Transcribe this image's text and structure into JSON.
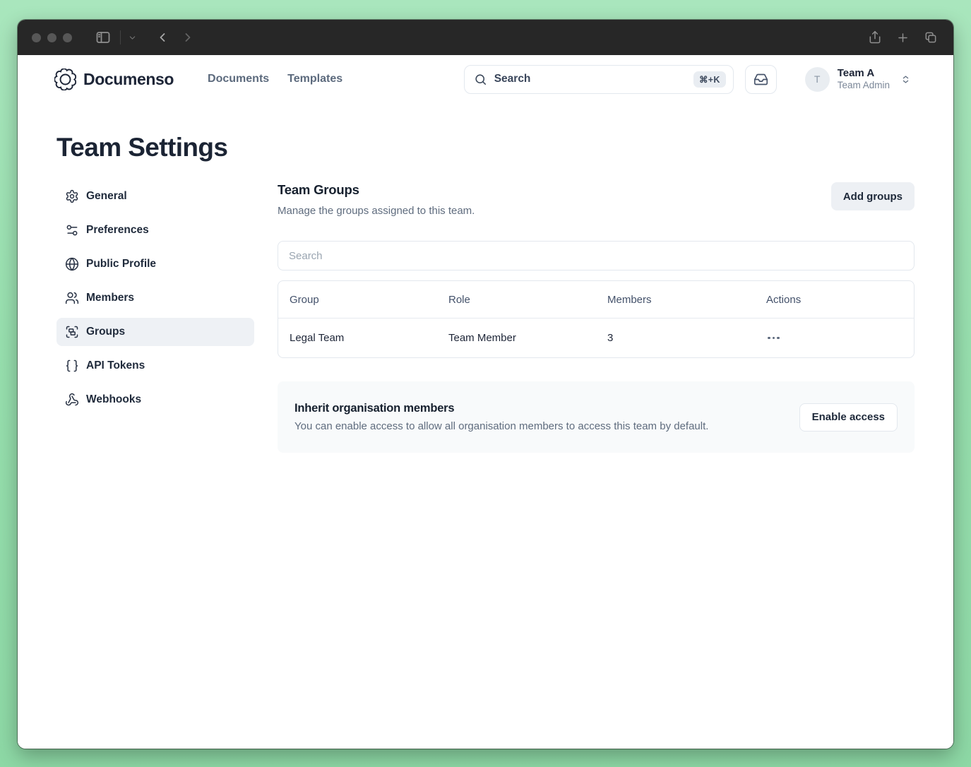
{
  "colors": {
    "desktop_background": "#97dfae",
    "titlebar": "#272727",
    "brand_ink": "#1d2537",
    "muted_slate": "#5f6c7e",
    "selected_item_bg": "#eef1f5",
    "card_bg": "#f8fafb",
    "border": "#e3e8ee"
  },
  "header": {
    "brand": "Documenso",
    "nav": [
      {
        "label": "Documents"
      },
      {
        "label": "Templates"
      }
    ],
    "search": {
      "placeholder": "Search",
      "shortcut": "⌘+K"
    },
    "team_menu": {
      "avatar_initial": "T",
      "team_name": "Team A",
      "role": "Team Admin"
    }
  },
  "page": {
    "title": "Team Settings"
  },
  "sidebar": {
    "items": [
      {
        "label": "General",
        "icon": "gear-icon"
      },
      {
        "label": "Preferences",
        "icon": "sliders-icon"
      },
      {
        "label": "Public Profile",
        "icon": "globe-icon"
      },
      {
        "label": "Members",
        "icon": "users-icon"
      },
      {
        "label": "Groups",
        "icon": "group-icon",
        "active": true
      },
      {
        "label": "API Tokens",
        "icon": "braces-icon"
      },
      {
        "label": "Webhooks",
        "icon": "webhook-icon"
      }
    ]
  },
  "main": {
    "section_title": "Team Groups",
    "section_description": "Manage the groups assigned to this team.",
    "add_groups_label": "Add groups",
    "filter_placeholder": "Search",
    "table": {
      "columns": [
        "Group",
        "Role",
        "Members",
        "Actions"
      ],
      "rows": [
        {
          "group": "Legal Team",
          "role": "Team Member",
          "members": "3"
        }
      ]
    },
    "inherit": {
      "title": "Inherit organisation members",
      "description": "You can enable access to allow all organisation members to access this team by default.",
      "button_label": "Enable access"
    }
  }
}
